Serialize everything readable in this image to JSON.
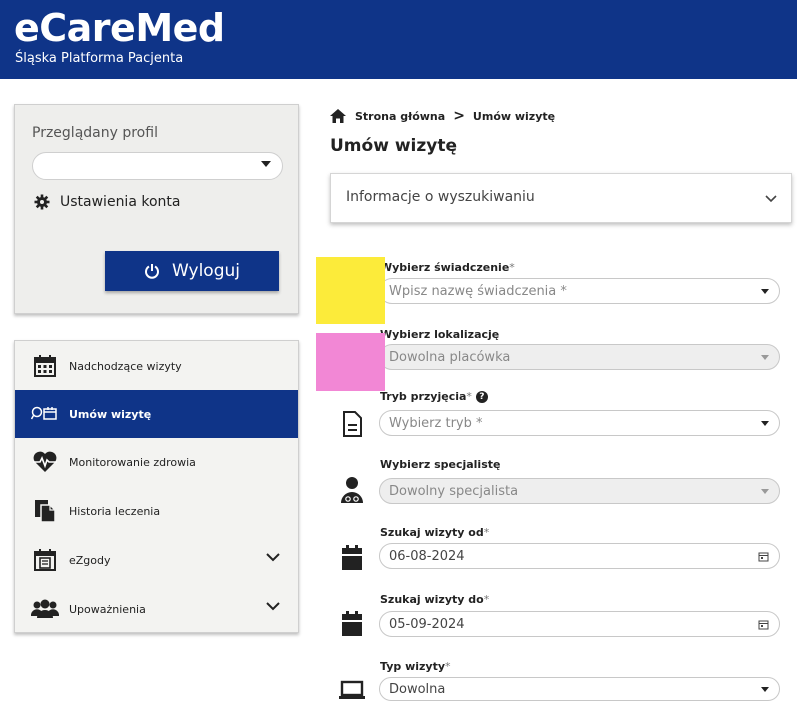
{
  "header": {
    "brand": "eCareMed",
    "subtitle": "Śląska Platforma Pacjenta"
  },
  "profile": {
    "label": "Przeglądany profil",
    "selected": "",
    "settings_label": "Ustawienia konta",
    "logout_label": "Wyloguj"
  },
  "menu": {
    "items": [
      {
        "label": "Nadchodzące wizyty",
        "icon": "calendar-icon"
      },
      {
        "label": "Umów wizytę",
        "icon": "search-calendar-icon",
        "active": true
      },
      {
        "label": "Monitorowanie zdrowia",
        "icon": "heart-pulse-icon"
      },
      {
        "label": "Historia leczenia",
        "icon": "documents-icon"
      },
      {
        "label": "eZgody",
        "icon": "consent-calendar-icon",
        "expandable": true
      },
      {
        "label": "Upoważnienia",
        "icon": "users-icon",
        "expandable": true
      }
    ]
  },
  "breadcrumb": {
    "home": "Strona główna",
    "current": "Umów wizytę"
  },
  "page_title": "Umów wizytę",
  "search_info": {
    "label": "Informacje o wyszukiwaniu"
  },
  "form": {
    "service": {
      "label": "Wybierz świadczenie",
      "req": "*",
      "placeholder": "Wpisz nazwę świadczenia *"
    },
    "location": {
      "label": "Wybierz lokalizację",
      "value": "Dowolna placówka"
    },
    "mode": {
      "label": "Tryb przyjęcia",
      "req": "*",
      "help": "?",
      "placeholder": "Wybierz tryb *"
    },
    "specialist": {
      "label": "Wybierz specjalistę",
      "value": "Dowolny specjalista"
    },
    "date_from": {
      "label": "Szukaj wizyty od",
      "req": "*",
      "value": "06-08-2024"
    },
    "date_to": {
      "label": "Szukaj wizyty do",
      "req": "*",
      "value": "05-09-2024"
    },
    "visit_type": {
      "label": "Typ wizyty",
      "req": "*",
      "value": "Dowolna"
    }
  },
  "colors": {
    "brand": "#0f3488",
    "redaction_yellow": "#fceb3a",
    "redaction_pink": "#f287d5"
  }
}
